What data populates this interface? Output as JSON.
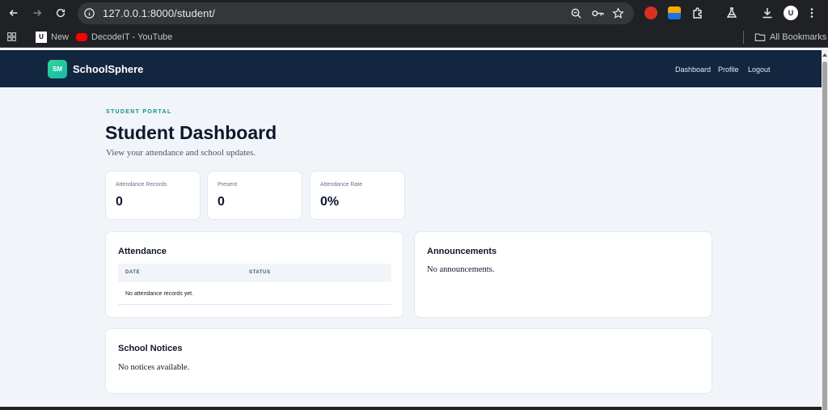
{
  "browser": {
    "url": "127.0.0.1:8000/student/",
    "bookmarks": [
      {
        "label": "New"
      },
      {
        "label": "DecodeIT - YouTube"
      }
    ],
    "all_bookmarks": "All Bookmarks",
    "profile_initial": "U"
  },
  "app": {
    "logo_text": "SM",
    "brand": "SchoolSphere",
    "nav": [
      {
        "label": "Dashboard"
      },
      {
        "label": "Profile"
      },
      {
        "label": "Logout"
      }
    ]
  },
  "header": {
    "eyebrow": "STUDENT PORTAL",
    "title": "Student Dashboard",
    "subtitle": "View your attendance and school updates."
  },
  "stats": [
    {
      "label": "Attendance Records",
      "value": "0"
    },
    {
      "label": "Present",
      "value": "0"
    },
    {
      "label": "Attendance Rate",
      "value": "0%"
    }
  ],
  "attendance": {
    "title": "Attendance",
    "columns": [
      "DATE",
      "STATUS"
    ],
    "empty": "No attendance records yet."
  },
  "announcements": {
    "title": "Announcements",
    "empty": "No announcements."
  },
  "notices": {
    "title": "School Notices",
    "empty": "No notices available."
  }
}
